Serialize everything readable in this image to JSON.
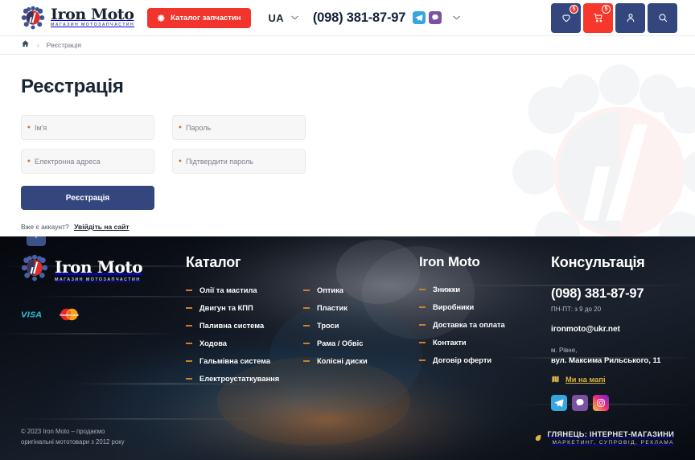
{
  "header": {
    "logo": {
      "name": "Iron Moto",
      "sub": "МАГАЗИН МОТОЗАПЧАСТИН"
    },
    "catalog_button": "Каталог запчастин",
    "language": "UA",
    "phone": "(098) 381-87-97",
    "messengers": [
      "telegram-icon",
      "viber-icon"
    ],
    "actions": [
      {
        "name": "wishlist",
        "icon": "heart-icon",
        "badge": "5"
      },
      {
        "name": "cart",
        "icon": "cart-icon",
        "badge": "5"
      },
      {
        "name": "account",
        "icon": "user-icon",
        "badge": ""
      },
      {
        "name": "search",
        "icon": "search-icon",
        "badge": ""
      }
    ]
  },
  "breadcrumb": {
    "home_icon": "home-icon",
    "separator": "›",
    "current": "Реєстрація"
  },
  "main": {
    "title": "Реєстрація",
    "fields": [
      {
        "key": "name",
        "placeholder": "Ім'я",
        "value": "",
        "required": true
      },
      {
        "key": "password",
        "placeholder": "Пароль",
        "value": "",
        "required": true
      },
      {
        "key": "email",
        "placeholder": "Електронна адреса",
        "value": "",
        "required": true
      },
      {
        "key": "password_confirm",
        "placeholder": "Підтвердити пароль",
        "value": "",
        "required": true
      }
    ],
    "submit": "Реєстрація",
    "have_account_text": "Вже є аккаунт?",
    "login_link": "Увійдіть на сайт"
  },
  "footer": {
    "scroll_top_icon": "arrow-up-icon",
    "logo": {
      "name": "Iron Moto",
      "sub": "МАГАЗИН МОТОЗАПЧАСТИН"
    },
    "payments": [
      "visa-icon",
      "mastercard-icon"
    ],
    "catalog": {
      "heading": "Каталог",
      "column1": [
        "Олії та мастила",
        "Двигун та КПП",
        "Паливна система",
        "Ходова",
        "Гальмівна система",
        "Електроустаткування"
      ],
      "column2": [
        "Оптика",
        "Пластик",
        "Троси",
        "Рама / Обвіс",
        "Колісні диски"
      ]
    },
    "shop": {
      "heading": "Iron Moto",
      "links": [
        "Знижки",
        "Виробники",
        "Доставка та оплата",
        "Контакти",
        "Договір оферти"
      ]
    },
    "consult": {
      "heading": "Консультація",
      "phone": "(098) 381-87-97",
      "hours": "ПН-ПТ: з 9 до 20",
      "email": "ironmoto@ukr.net",
      "address_city": "м. Рівне,",
      "address_street": "вул. Максима Рильського, 11",
      "map_link": "Ми на мапі",
      "map_icon": "map-icon",
      "socials": [
        "telegram-icon",
        "viber-icon",
        "instagram-icon"
      ]
    },
    "bottom": {
      "copyright_line1": "© 2023 Iron Moto – продаємо",
      "copyright_line2": "оригінальні мототовари з 2012 року",
      "dev_name": "ГЛЯНЕЦЬ: ІНТЕРНЕТ-МАГАЗИНИ",
      "dev_tagline": "МАРКЕТИНГ, СУПРОВІД, РЕКЛАМА",
      "dev_icon": "leaf-icon"
    }
  },
  "colors": {
    "accent_red": "#f1342c",
    "navy": "#33477e",
    "gold": "#d9b642",
    "dash_orange": "#c9802f"
  }
}
